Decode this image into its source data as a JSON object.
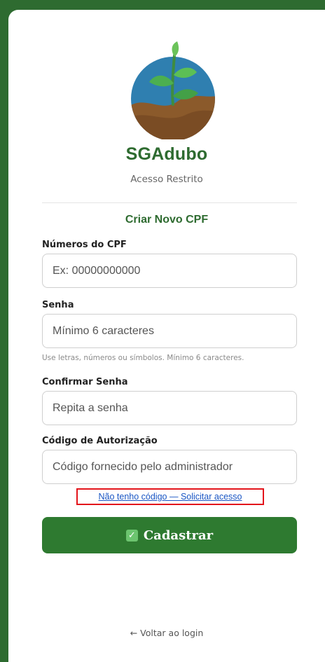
{
  "brand": {
    "name": "SGAdubo",
    "subtitle": "Acesso Restrito"
  },
  "form": {
    "title": "Criar Novo CPF",
    "cpf": {
      "label": "Números do CPF",
      "placeholder": "Ex: 00000000000",
      "value": ""
    },
    "password": {
      "label": "Senha",
      "placeholder": "Mínimo 6 caracteres",
      "value": ""
    },
    "password_hint": "Use letras, números ou símbolos. Mínimo 6 caracteres.",
    "confirm": {
      "label": "Confirmar Senha",
      "placeholder": "Repita a senha",
      "value": ""
    },
    "auth_code": {
      "label": "Código de Autorização",
      "placeholder": "Código fornecido pelo administrador",
      "value": ""
    },
    "request_access_link": "Não tenho código — Solicitar acesso",
    "submit_label": "Cadastrar",
    "submit_icon": "check-box-icon"
  },
  "back_link": "← Voltar ao login",
  "colors": {
    "frame": "#2e6b30",
    "brand_green": "#2e6b30",
    "button_green": "#2e7a30",
    "link_blue": "#1a55c4",
    "highlight_red": "#e3141b"
  }
}
